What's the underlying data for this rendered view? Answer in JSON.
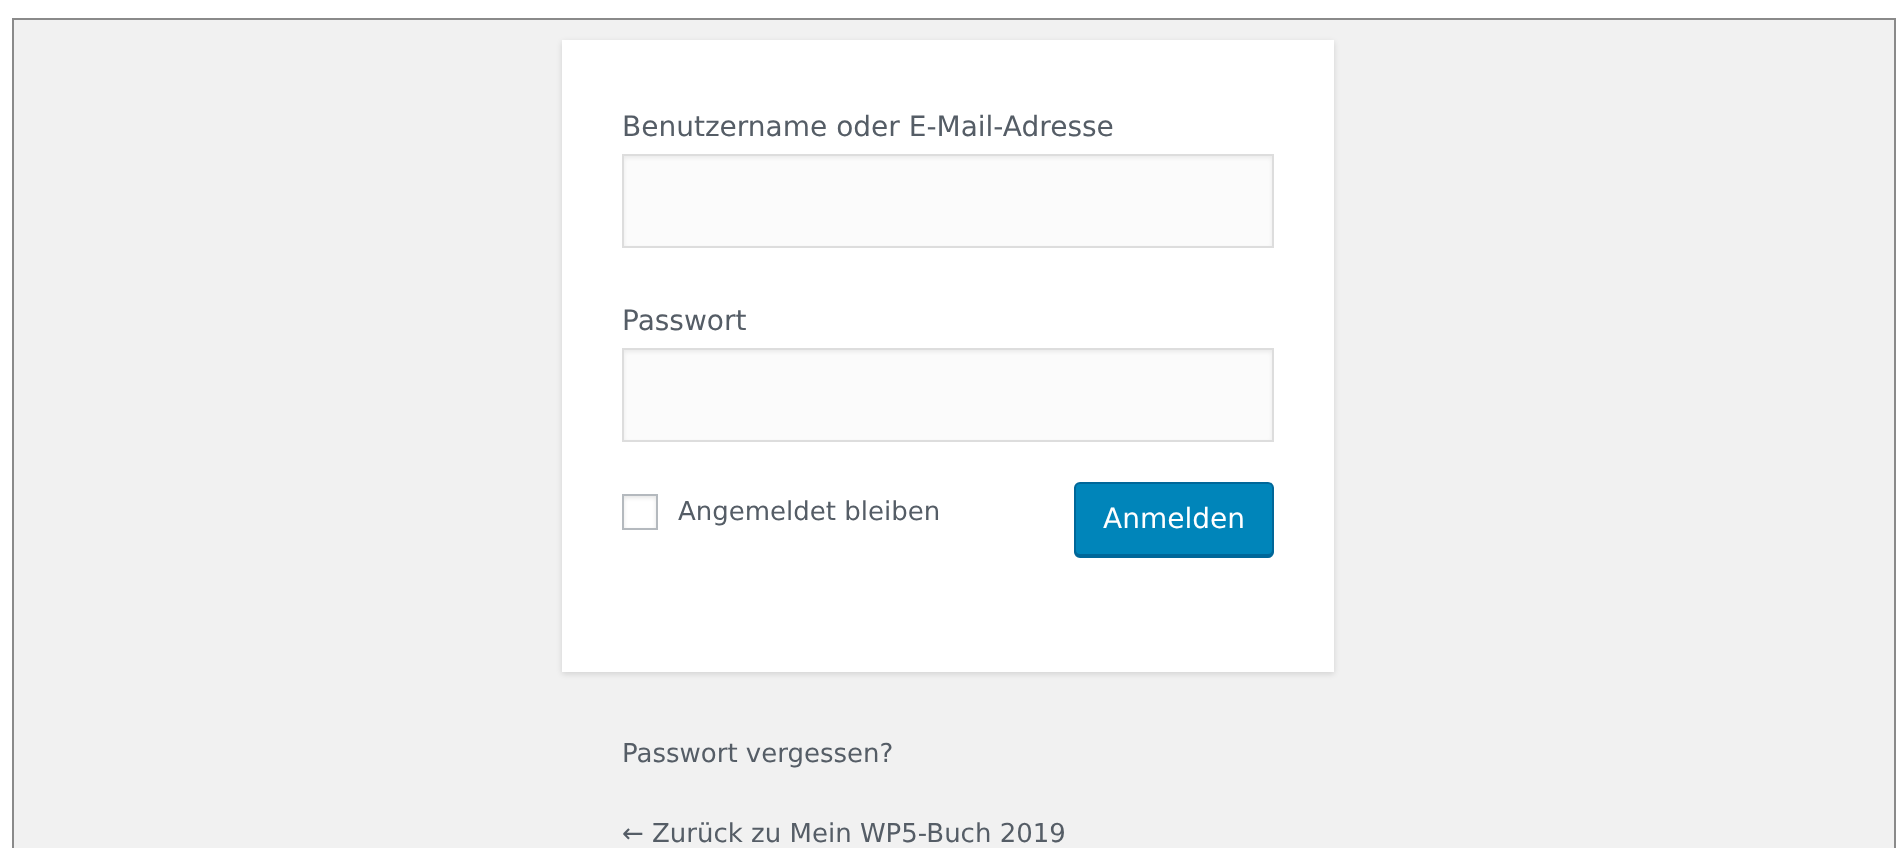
{
  "login_form": {
    "fields": [
      {
        "label": "Benutzername oder E-Mail-Adresse"
      },
      {
        "label": "Passwort"
      }
    ],
    "remember_me": {
      "label": "Angemeldet bleiben",
      "checked": false
    },
    "submit_button": "Anmelden"
  },
  "links": [
    "Passwort vergessen?",
    "← Zurück zu Mein WP5-Buch 2019"
  ]
}
